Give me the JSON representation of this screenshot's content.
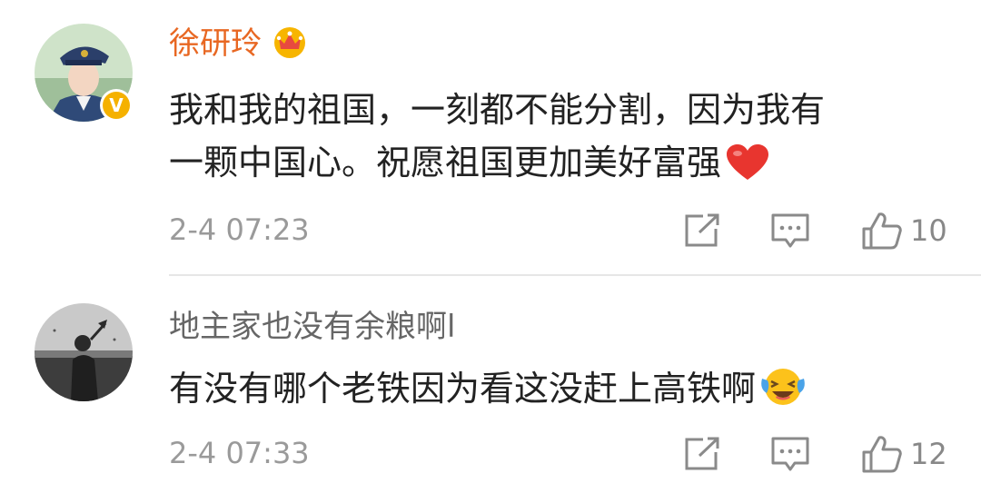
{
  "comments": [
    {
      "username": "徐研玲",
      "username_color": "#e86722",
      "badge_icon": "crown-icon",
      "verified_icon": "verified-v-icon",
      "verified_label": "V",
      "lines": [
        "我和我的祖国，一刻都不能分割，因为我有",
        "一颗中国心。祝愿祖国更加美好富强"
      ],
      "emoji": "red-heart-emoji",
      "time": "2-4 07:23",
      "like_count": "10"
    },
    {
      "username": "地主家也没有余粮啊l",
      "username_color": "#666666",
      "lines": [
        "有没有哪个老铁因为看这没赶上高铁啊"
      ],
      "emoji": "laughing-crying-emoji",
      "time": "2-4 07:33",
      "like_count": "12"
    }
  ],
  "colors": {
    "icon_gray": "#8a8a8a",
    "text": "#222222",
    "meta": "#9a9a9a",
    "verified_badge": "#f5b100"
  }
}
